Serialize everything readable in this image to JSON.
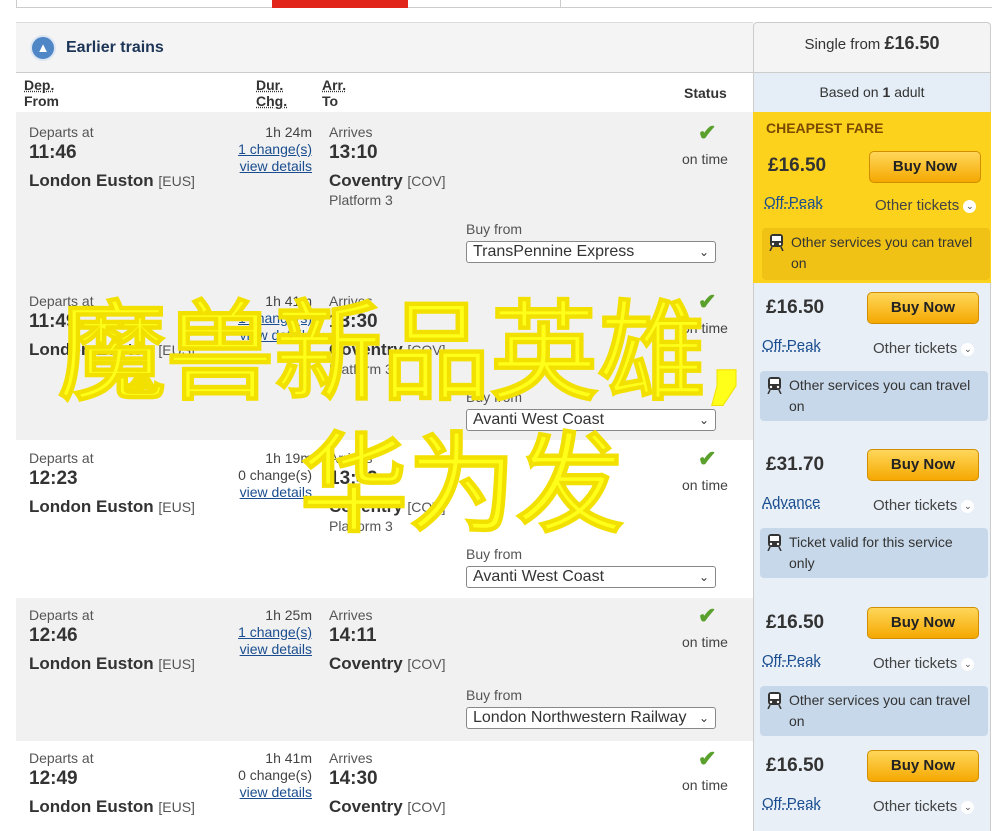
{
  "header": {
    "earlier_label": "Earlier trains",
    "single_from_prefix": "Single from",
    "single_from_price": "£16.50",
    "based_on_prefix": "Based on",
    "based_on_count": "1",
    "based_on_suffix": "adult"
  },
  "columns": {
    "dep_line1": "Dep.",
    "dep_line2": "From",
    "dur_line1": "Dur.",
    "dur_line2": "Chg.",
    "arr_line1": "Arr.",
    "arr_line2": "To",
    "status": "Status"
  },
  "labels": {
    "departs_at": "Departs at",
    "arrives": "Arrives",
    "buy_from": "Buy from",
    "view_details": "view details",
    "buy_now": "Buy Now",
    "other_tickets": "Other tickets",
    "cheapest_fare": "CHEAPEST FARE"
  },
  "journeys": [
    {
      "depart_time": "11:46",
      "from": "London Euston",
      "from_code": "[EUS]",
      "duration": "1h 24m",
      "changes": "1 change(s)",
      "arrive_time": "13:10",
      "to": "Coventry",
      "to_code": "[COV]",
      "platform": "Platform 3",
      "status": "on time",
      "operator": "TransPennine Express",
      "price": "£16.50",
      "fare_type": "Off-Peak",
      "note": "Other services you can travel on"
    },
    {
      "depart_time": "11:49",
      "from": "London Euston",
      "from_code": "[EUS]",
      "duration": "1h 41m",
      "changes": "1 change(s)",
      "arrive_time": "13:30",
      "to": "Coventry",
      "to_code": "[COV]",
      "platform": "Platform 3",
      "status": "on time",
      "operator": "Avanti West Coast",
      "price": "£16.50",
      "fare_type": "Off-Peak",
      "note": "Other services you can travel on"
    },
    {
      "depart_time": "12:23",
      "from": "London Euston",
      "from_code": "[EUS]",
      "duration": "1h 19m",
      "changes": "0 change(s)",
      "arrive_time": "13:42",
      "to": "Coventry",
      "to_code": "[COV]",
      "platform": "Platform 3",
      "status": "on time",
      "operator": "Avanti West Coast",
      "price": "£31.70",
      "fare_type": "Advance",
      "note": "Ticket valid for this service only"
    },
    {
      "depart_time": "12:46",
      "from": "London Euston",
      "from_code": "[EUS]",
      "duration": "1h 25m",
      "changes": "1 change(s)",
      "arrive_time": "14:11",
      "to": "Coventry",
      "to_code": "[COV]",
      "platform": "",
      "status": "on time",
      "operator": "London Northwestern Railway",
      "price": "£16.50",
      "fare_type": "Off-Peak",
      "note": "Other services you can travel on"
    },
    {
      "depart_time": "12:49",
      "from": "London Euston",
      "from_code": "[EUS]",
      "duration": "1h 41m",
      "changes": "0 change(s)",
      "arrive_time": "14:30",
      "to": "Coventry",
      "to_code": "[COV]",
      "platform": "",
      "status": "on time",
      "operator": "",
      "price": "£16.50",
      "fare_type": "Off-Peak",
      "note": ""
    }
  ],
  "overlay": {
    "line1": "魔兽新品英雄,",
    "line2": "华为发"
  },
  "colors": {
    "cheapest_bg": "#fcd21d",
    "buy_button": "#f5a800",
    "overlay_text": "#ffff1a",
    "ok_check": "#5aa02c"
  }
}
